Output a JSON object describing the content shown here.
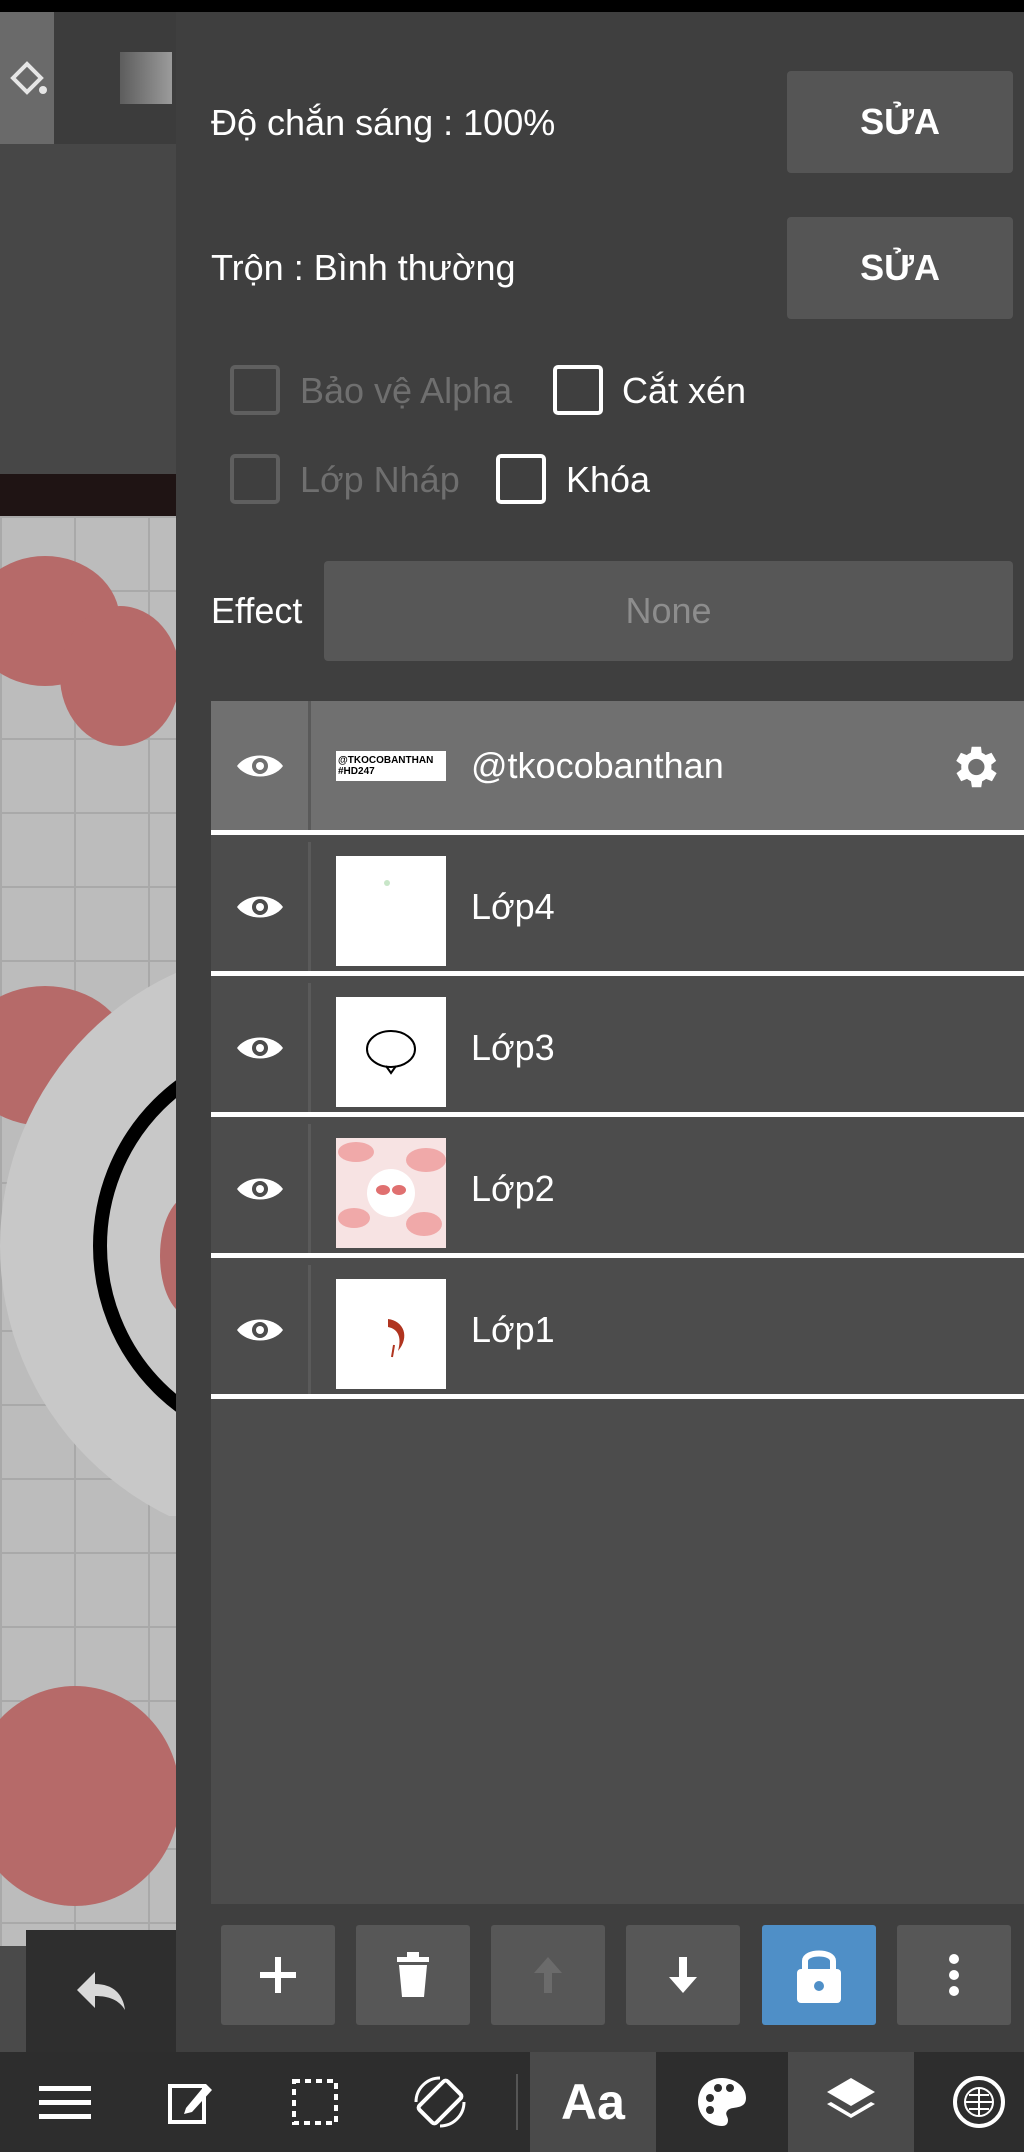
{
  "panel": {
    "opacity": {
      "label": "Độ chắn sáng : 100%",
      "button": "SỬA"
    },
    "blend": {
      "label": "Trộn : Bình thường",
      "button": "SỬA"
    },
    "checkboxes": {
      "protect_alpha": {
        "label": "Bảo vệ Alpha",
        "checked": false,
        "enabled": false
      },
      "clipping": {
        "label": "Cắt xén",
        "checked": false,
        "enabled": true
      },
      "draft_layer": {
        "label": "Lớp Nháp",
        "checked": false,
        "enabled": false
      },
      "lock": {
        "label": "Khóa",
        "checked": false,
        "enabled": true
      }
    },
    "effect": {
      "label": "Effect",
      "value": "None"
    }
  },
  "layers": [
    {
      "name": "@tkocobanthan",
      "thumb_text": "@TKOCOBANTHAN #HD247",
      "selected": true,
      "visible": true
    },
    {
      "name": "Lớp4",
      "selected": false,
      "visible": true
    },
    {
      "name": "Lớp3",
      "selected": false,
      "visible": true
    },
    {
      "name": "Lớp2",
      "selected": false,
      "visible": true
    },
    {
      "name": "Lớp1",
      "selected": false,
      "visible": true
    }
  ],
  "layer_actions": [
    {
      "icon": "plus-icon",
      "enabled": true
    },
    {
      "icon": "trash-icon",
      "enabled": true
    },
    {
      "icon": "arrow-up-icon",
      "enabled": false
    },
    {
      "icon": "arrow-down-icon",
      "enabled": true
    },
    {
      "icon": "lock-icon",
      "active": true
    },
    {
      "icon": "more-vertical-icon",
      "enabled": true
    }
  ],
  "bottombar": {
    "text_tool_label": "Aa",
    "items": [
      "menu-icon",
      "edit-icon",
      "selection-icon",
      "rotate-icon",
      "text-tool",
      "palette-icon",
      "layers-icon",
      "material-icon"
    ],
    "highlighted": [
      "text-tool",
      "layers-icon"
    ]
  },
  "colors": {
    "panel_bg": "#3f3f3f",
    "layer_list_bg": "#4c4c4c",
    "selected_layer": "#707070",
    "button_bg": "#555555",
    "lock_active": "#4f8fc7",
    "canvas_heart": "#b66a69"
  }
}
